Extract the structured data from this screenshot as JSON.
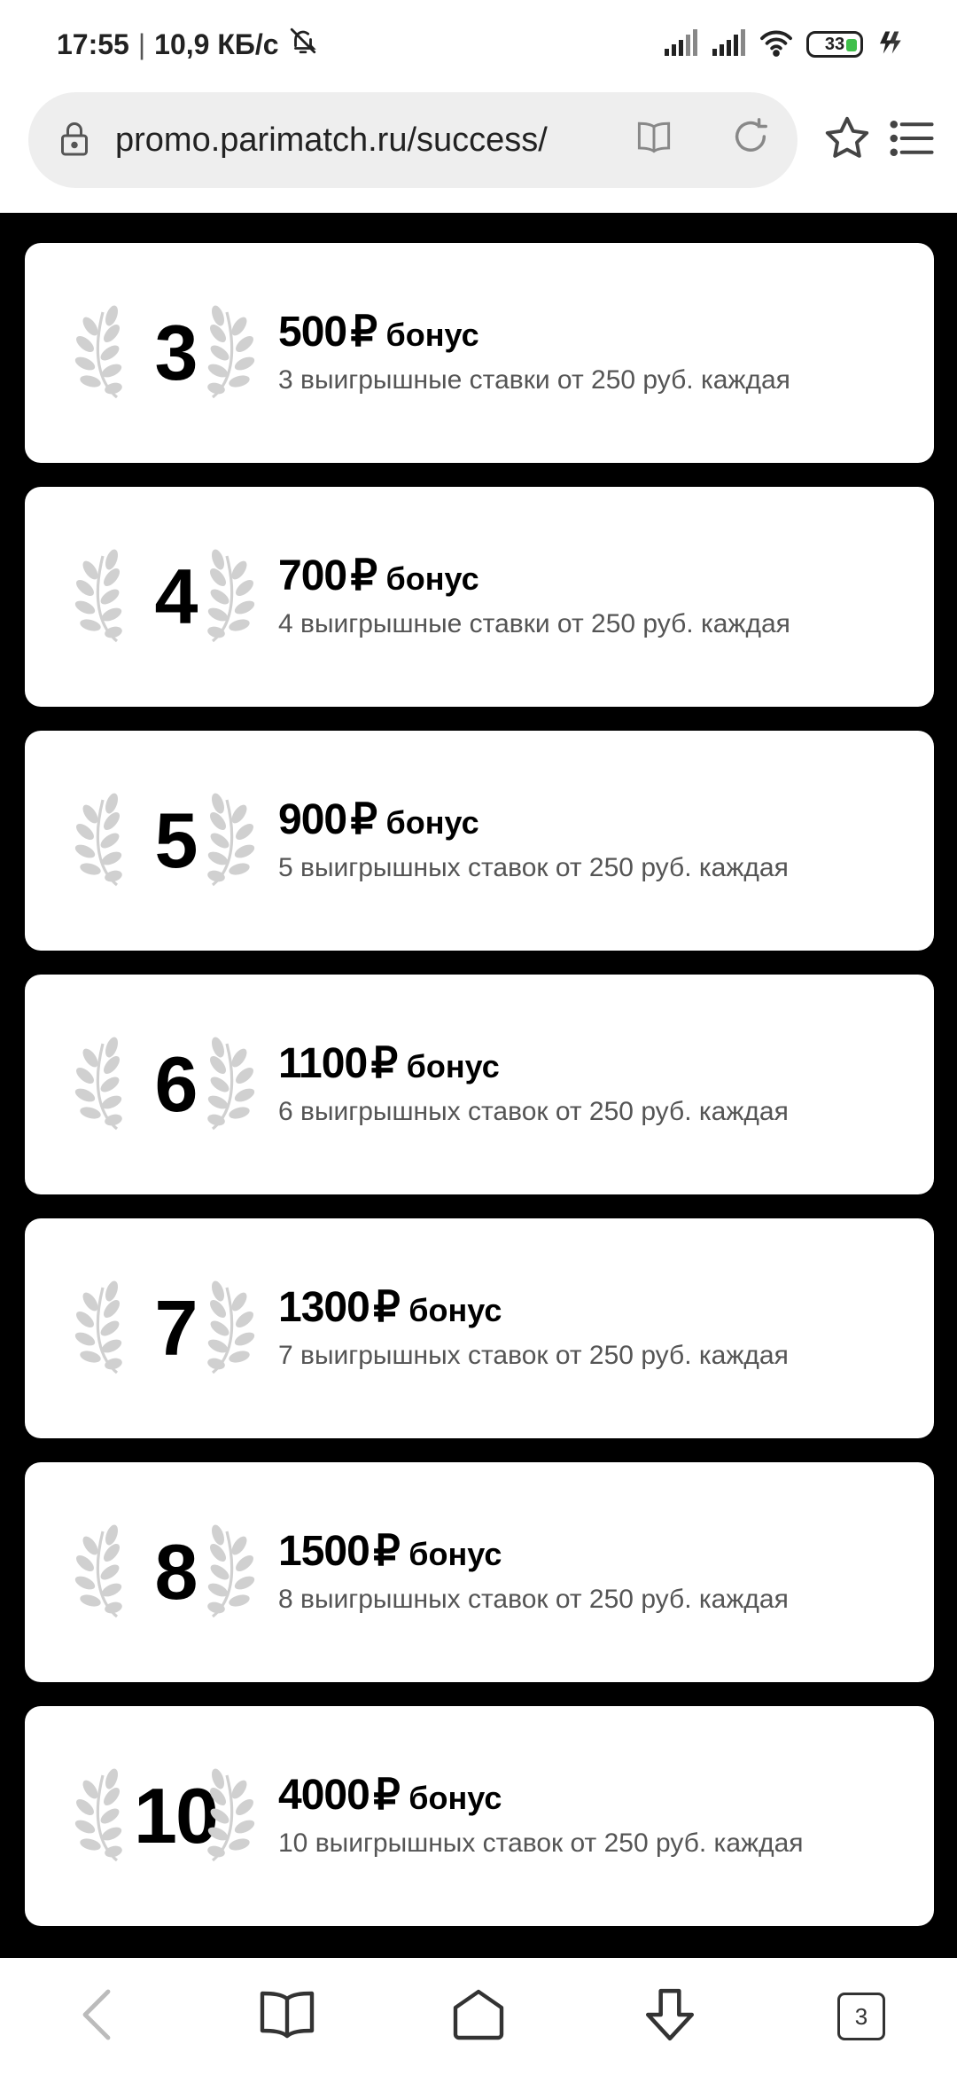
{
  "status_bar": {
    "time": "17:55",
    "speed": "10,9 КБ/с",
    "battery": "33"
  },
  "address_bar": {
    "url": "promo.parimatch.ru/success/"
  },
  "currency_symbol": "₽",
  "bonus_word": "бонус",
  "levels": [
    {
      "number": "3",
      "amount": "500",
      "description": "3 выигрышные ставки от 250 руб. каждая"
    },
    {
      "number": "4",
      "amount": "700",
      "description": "4 выигрышные ставки от 250 руб. каждая"
    },
    {
      "number": "5",
      "amount": "900",
      "description": "5 выигрышных ставок от 250 руб. каждая"
    },
    {
      "number": "6",
      "amount": "1100",
      "description": "6 выигрышных ставок от 250 руб. каждая"
    },
    {
      "number": "7",
      "amount": "1300",
      "description": "7 выигрышных ставок от 250 руб. каждая"
    },
    {
      "number": "8",
      "amount": "1500",
      "description": "8 выигрышных ставок от 250 руб. каждая"
    },
    {
      "number": "10",
      "amount": "4000",
      "description": "10 выигрышных ставок от 250 руб. каждая"
    }
  ],
  "bottom_nav": {
    "tabs_count": "3"
  },
  "colors": {
    "background": "#000000",
    "card": "#ffffff",
    "laurel": "#d0d0d0",
    "battery_indicator": "#3fbf4a"
  }
}
